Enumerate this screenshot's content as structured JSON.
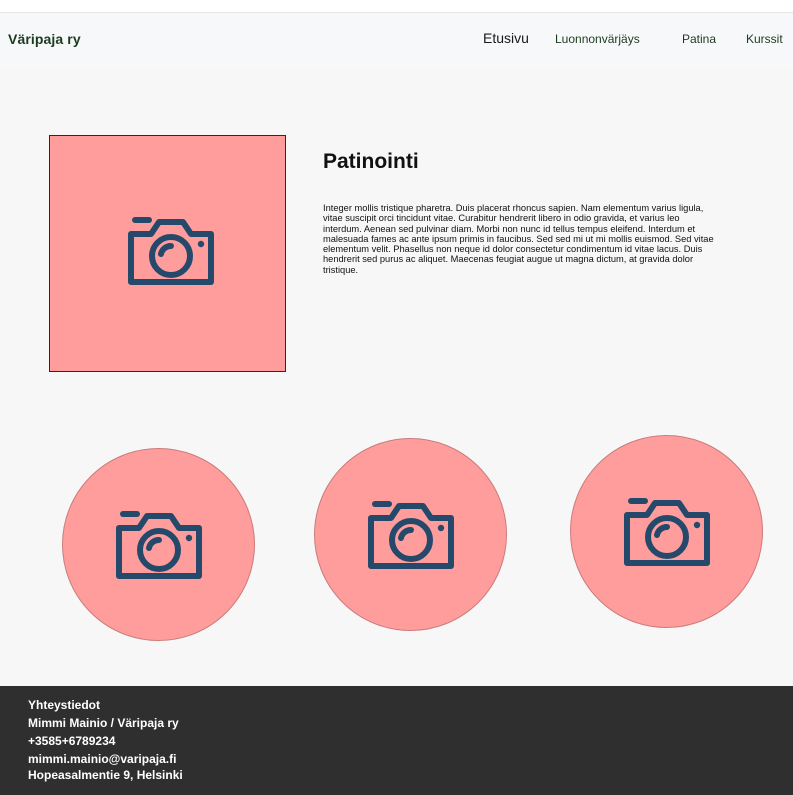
{
  "header": {
    "brand": "Väripaja ry",
    "nav": [
      "Etusivu",
      "Luonnonvärjäys",
      "Patina",
      "Kurssit"
    ]
  },
  "article": {
    "title": "Patinointi",
    "body": "Integer mollis tristique pharetra. Duis placerat rhoncus sapien. Nam elementum varius ligula, vitae suscipit orci tincidunt vitae. Curabitur hendrerit libero in odio gravida, et varius leo interdum. Aenean sed pulvinar diam. Morbi non nunc id tellus tempus eleifend. Interdum et malesuada fames ac ante ipsum primis in faucibus. Sed sed mi ut mi mollis euismod. Sed vitae elementum velit. Phasellus non neque id dolor consectetur condimentum id vitae lacus. Duis hendrerit sed purus ac aliquet. Maecenas feugiat augue ut magna dictum, at gravida dolor tristique.",
    "image_icon": "camera-icon"
  },
  "gallery": {
    "icons": [
      "camera-icon",
      "camera-icon",
      "camera-icon"
    ]
  },
  "footer": {
    "heading": "Yhteystiedot",
    "name": "Mimmi Mainio / Väripaja ry",
    "phone": "+3585+6789234",
    "email": "mimmi.mainio@varipaja.fi",
    "address": "Hopeasalmentie 9, Helsinki"
  },
  "colors": {
    "placeholder_bg": "#ff9d9d",
    "icon": "#24496b",
    "footer_bg": "#2f2f2f",
    "main_bg": "#f7f7f7",
    "nav_text": "#1d3a1f"
  }
}
